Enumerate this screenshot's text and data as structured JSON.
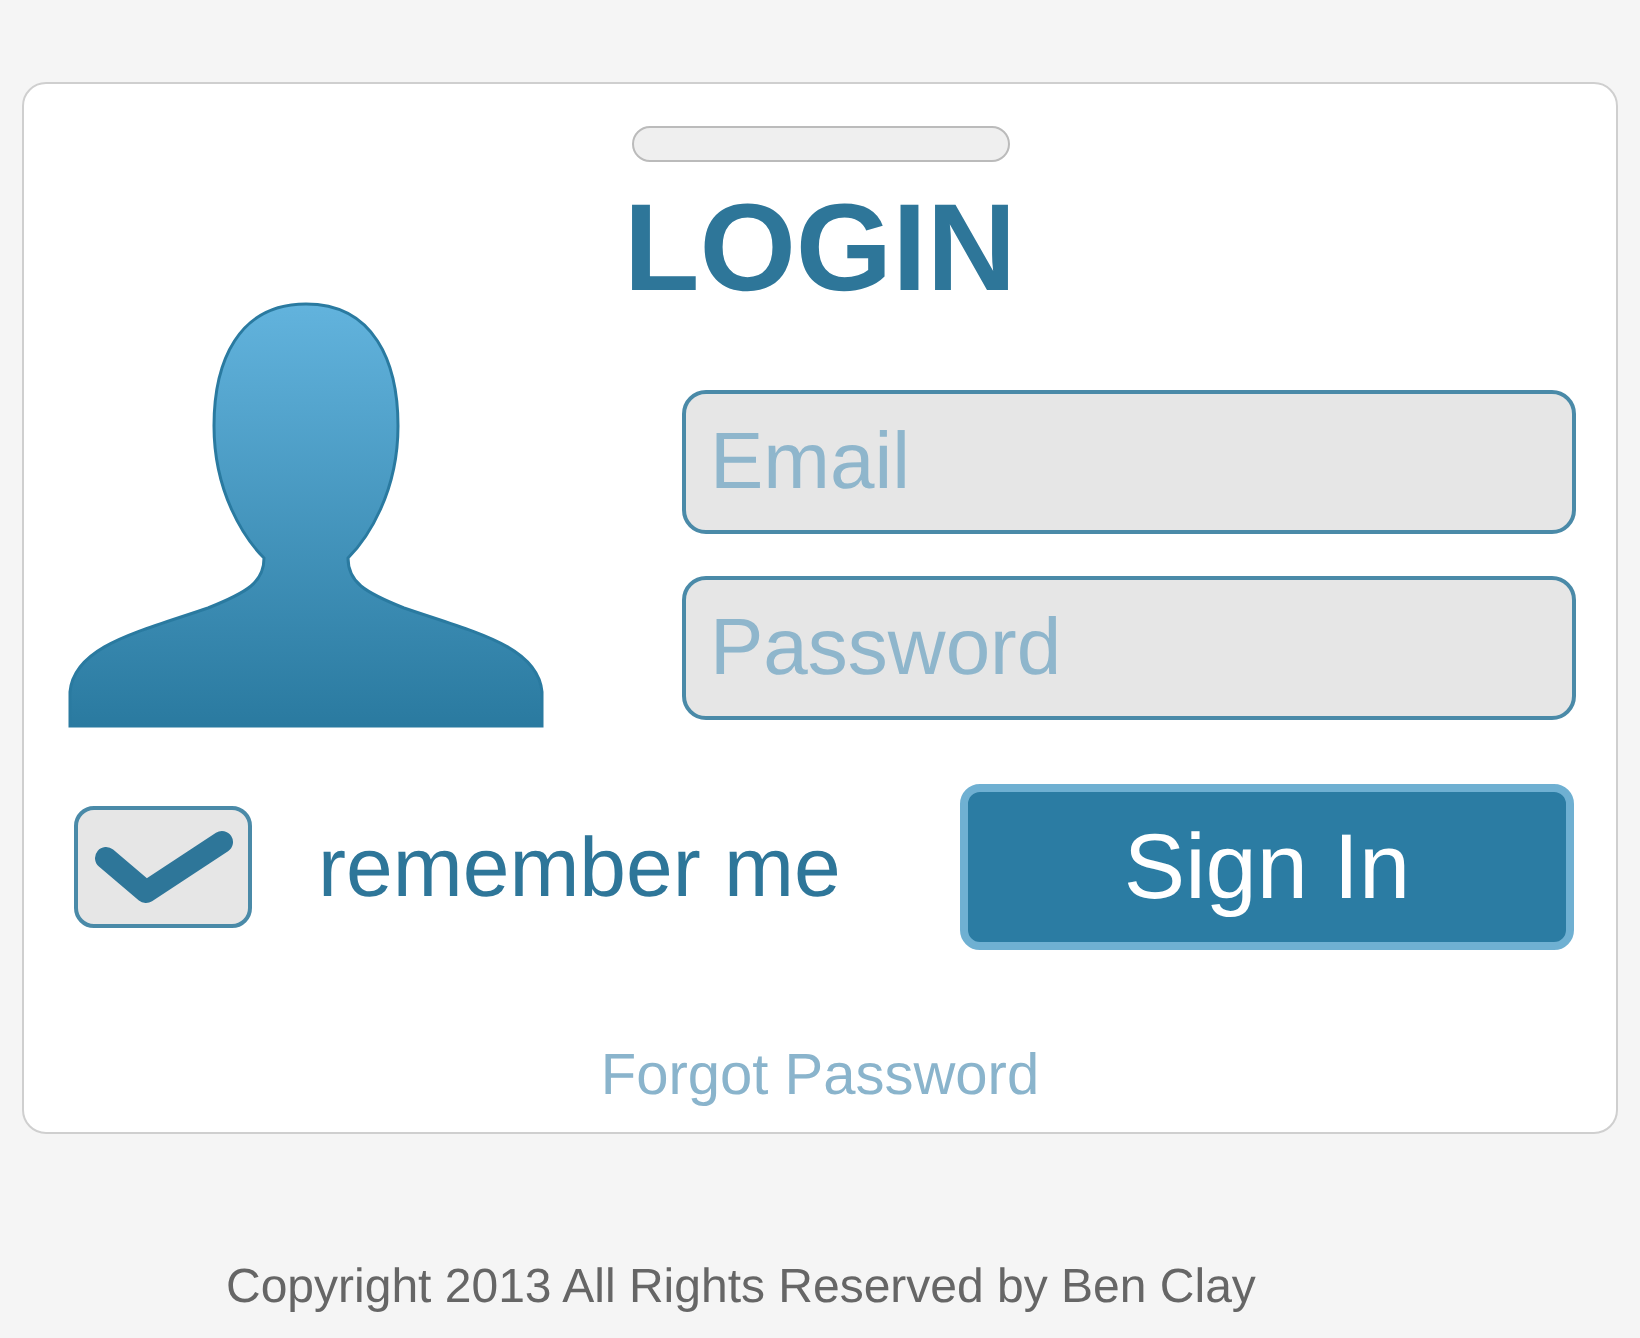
{
  "title": "LOGIN",
  "fields": [
    {
      "placeholder": "Email"
    },
    {
      "placeholder": "Password"
    }
  ],
  "remember": {
    "label": "remember me",
    "checked": true
  },
  "sign_in": "Sign In",
  "forgot": "Forgot Password",
  "footer": "Copyright 2013 All Rights Reserved by Ben Clay"
}
